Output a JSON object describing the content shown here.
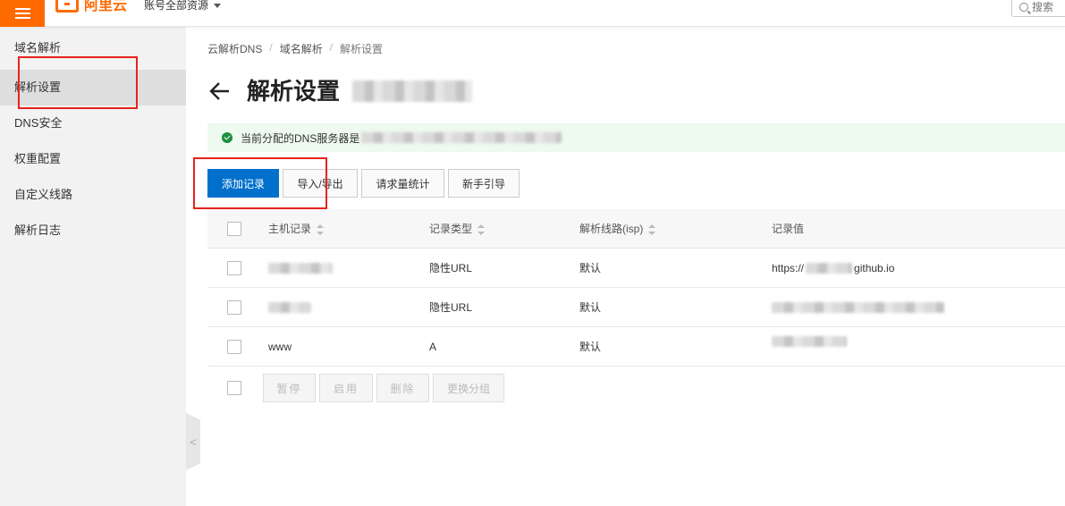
{
  "topbar": {
    "brand": "阿里云",
    "account_label": "账号全部资源",
    "search_placeholder": "搜索"
  },
  "sidebar": {
    "items": [
      {
        "label": "域名解析",
        "active": false
      },
      {
        "label": "解析设置",
        "active": true
      },
      {
        "label": "DNS安全",
        "active": false
      },
      {
        "label": "权重配置",
        "active": false
      },
      {
        "label": "自定义线路",
        "active": false
      },
      {
        "label": "解析日志",
        "active": false
      }
    ],
    "collapse_glyph": "<"
  },
  "breadcrumb": {
    "items": [
      "云解析DNS",
      "域名解析",
      "解析设置"
    ],
    "separator": "/"
  },
  "page_title": "解析设置",
  "alert": {
    "text": "当前分配的DNS服务器是"
  },
  "toolbar": {
    "add_record": "添加记录",
    "import_export": "导入/导出",
    "request_stats": "请求量统计",
    "guide": "新手引导"
  },
  "table": {
    "headers": {
      "host": "主机记录",
      "type": "记录类型",
      "line": "解析线路(isp)",
      "value": "记录值"
    },
    "rows": [
      {
        "host": "",
        "type": "隐性URL",
        "line": "默认",
        "value": "https://",
        "value_suffix": "github.io"
      },
      {
        "host": "",
        "type": "隐性URL",
        "line": "默认",
        "value": "",
        "value_suffix": ""
      },
      {
        "host": "www",
        "type": "A",
        "line": "默认",
        "value": "",
        "value_suffix": ""
      }
    ]
  },
  "bulk_actions": {
    "pause": "暂停",
    "enable": "启用",
    "delete": "删除",
    "change_group": "更换分组"
  },
  "colors": {
    "brand": "#ff6a00",
    "primary": "#0070cc",
    "annotation": "#e8221c",
    "success": "#1e8e3e"
  }
}
